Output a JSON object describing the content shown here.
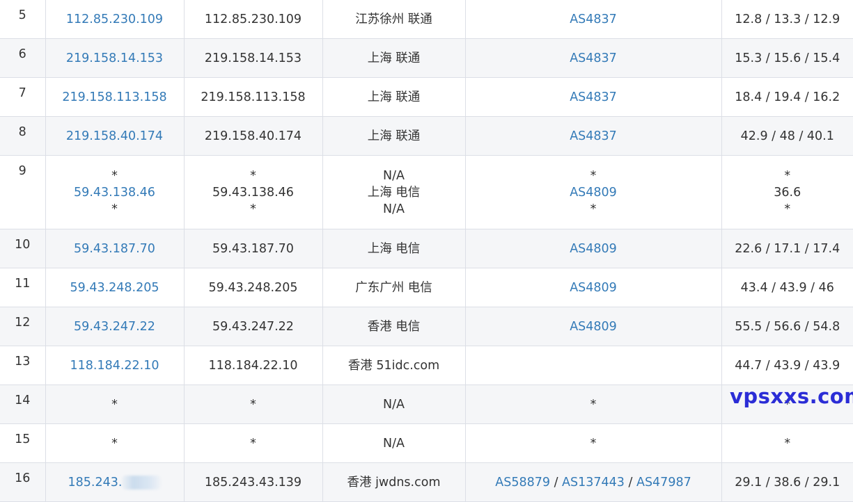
{
  "watermark": "vpsxxs.com",
  "rows": [
    {
      "hop": "5",
      "ip": [
        "112.85.230.109"
      ],
      "host": [
        "112.85.230.109"
      ],
      "loc": [
        "江苏徐州 联通"
      ],
      "asn": [
        [
          "AS4837"
        ]
      ],
      "time": [
        "12.8 / 13.3 / 12.9"
      ]
    },
    {
      "hop": "6",
      "ip": [
        "219.158.14.153"
      ],
      "host": [
        "219.158.14.153"
      ],
      "loc": [
        "上海 联通"
      ],
      "asn": [
        [
          "AS4837"
        ]
      ],
      "time": [
        "15.3 / 15.6 / 15.4"
      ]
    },
    {
      "hop": "7",
      "ip": [
        "219.158.113.158"
      ],
      "host": [
        "219.158.113.158"
      ],
      "loc": [
        "上海 联通"
      ],
      "asn": [
        [
          "AS4837"
        ]
      ],
      "time": [
        "18.4 / 19.4 / 16.2"
      ]
    },
    {
      "hop": "8",
      "ip": [
        "219.158.40.174"
      ],
      "host": [
        "219.158.40.174"
      ],
      "loc": [
        "上海 联通"
      ],
      "asn": [
        [
          "AS4837"
        ]
      ],
      "time": [
        "42.9 / 48 / 40.1"
      ]
    },
    {
      "hop": "9",
      "ip": [
        "*",
        "59.43.138.46",
        "*"
      ],
      "host": [
        "*",
        "59.43.138.46",
        "*"
      ],
      "loc": [
        "N/A",
        "上海 电信",
        "N/A"
      ],
      "asn": [
        [
          "*"
        ],
        [
          "AS4809"
        ],
        [
          "*"
        ]
      ],
      "time": [
        "*",
        "36.6",
        "*"
      ]
    },
    {
      "hop": "10",
      "ip": [
        "59.43.187.70"
      ],
      "host": [
        "59.43.187.70"
      ],
      "loc": [
        "上海 电信"
      ],
      "asn": [
        [
          "AS4809"
        ]
      ],
      "time": [
        "22.6 / 17.1 / 17.4"
      ]
    },
    {
      "hop": "11",
      "ip": [
        "59.43.248.205"
      ],
      "host": [
        "59.43.248.205"
      ],
      "loc": [
        "广东广州 电信"
      ],
      "asn": [
        [
          "AS4809"
        ]
      ],
      "time": [
        "43.4 / 43.9 / 46"
      ]
    },
    {
      "hop": "12",
      "ip": [
        "59.43.247.22"
      ],
      "host": [
        "59.43.247.22"
      ],
      "loc": [
        "香港 电信"
      ],
      "asn": [
        [
          "AS4809"
        ]
      ],
      "time": [
        "55.5 / 56.6 / 54.8"
      ]
    },
    {
      "hop": "13",
      "ip": [
        "118.184.22.10"
      ],
      "host": [
        "118.184.22.10"
      ],
      "loc": [
        "香港 51idc.com"
      ],
      "asn": [
        []
      ],
      "time": [
        "44.7 / 43.9 / 43.9"
      ]
    },
    {
      "hop": "14",
      "ip": [
        "*"
      ],
      "host": [
        "*"
      ],
      "loc": [
        "N/A"
      ],
      "asn": [
        [
          "*"
        ]
      ],
      "time": [
        "*"
      ]
    },
    {
      "hop": "15",
      "ip": [
        "*"
      ],
      "host": [
        "*"
      ],
      "loc": [
        "N/A"
      ],
      "asn": [
        [
          "*"
        ]
      ],
      "time": [
        "*"
      ]
    },
    {
      "hop": "16",
      "ip": [
        "185.243."
      ],
      "ip_redacted": true,
      "host": [
        "185.243.43.139"
      ],
      "loc": [
        "香港 jwdns.com"
      ],
      "asn": [
        [
          "AS58879",
          "AS137443",
          "AS47987"
        ]
      ],
      "time": [
        "29.1 / 38.6 / 29.1"
      ]
    }
  ]
}
